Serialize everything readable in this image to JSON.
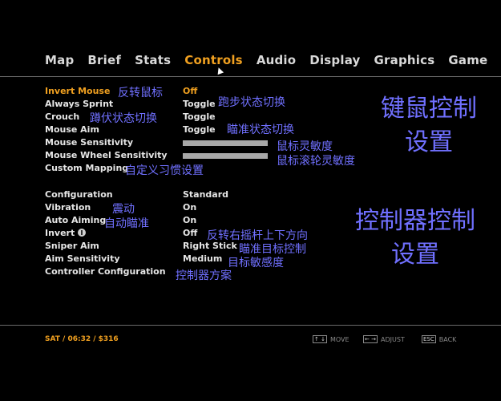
{
  "tabs": [
    "Map",
    "Brief",
    "Stats",
    "Controls",
    "Audio",
    "Display",
    "Graphics",
    "Game"
  ],
  "active_tab": "Controls",
  "mouse_settings": [
    {
      "label": "Invert Mouse",
      "value": "Off",
      "note": "反转鼠标"
    },
    {
      "label": "Always Sprint",
      "value": "Toggle",
      "note": "跑步状态切换"
    },
    {
      "label": "Crouch",
      "value": "Toggle",
      "note": "蹲伏状态切换"
    },
    {
      "label": "Mouse Aim",
      "value": "Toggle",
      "note": "瞄准状态切换"
    },
    {
      "label": "Mouse Sensitivity",
      "note": "鼠标灵敏度",
      "level": 0.5
    },
    {
      "label": "Mouse Wheel Sensitivity",
      "note": "鼠标滚轮灵敏度",
      "level": 0.5
    },
    {
      "label": "Custom Mapping",
      "note": "自定义习惯设置"
    }
  ],
  "mouse_section_note": "键鼠控制\n设置",
  "controller_settings": [
    {
      "label": "Configuration",
      "value": "Standard"
    },
    {
      "label": "Vibration",
      "value": "On",
      "note": "震动"
    },
    {
      "label": "Auto Aiming",
      "value": "On",
      "note": "自动瞄准"
    },
    {
      "label": "Invert",
      "value": "Off",
      "note": "反转右摇杆上下方向"
    },
    {
      "label": "Sniper Aim",
      "value": "Right Stick",
      "note": "瞄准目标控制"
    },
    {
      "label": "Aim Sensitivity",
      "value": "Medium",
      "note": "目标敏感度"
    },
    {
      "label": "Controller Configuration",
      "note": "控制器方案"
    }
  ],
  "controller_section_note": "控制器控制\n设置",
  "status": "SAT  /  06:32  /  $316",
  "hints": [
    {
      "keys": "↑ ↓",
      "label": "MOVE"
    },
    {
      "keys": "← →",
      "label": "ADJUST"
    },
    {
      "keys": "ESC",
      "label": "BACK"
    }
  ]
}
